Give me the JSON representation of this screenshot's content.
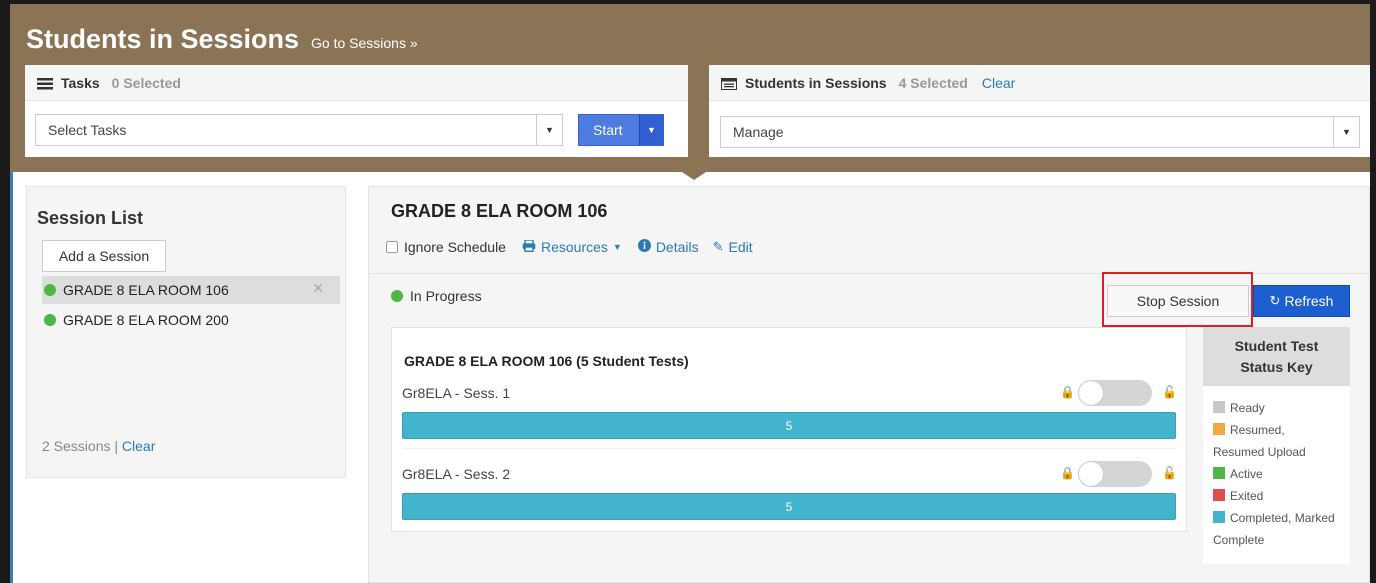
{
  "header": {
    "title": "Students in Sessions",
    "go_link": "Go to Sessions »"
  },
  "tasks_panel": {
    "title": "Tasks",
    "selected": "0 Selected",
    "select_value": "Select Tasks",
    "start_label": "Start"
  },
  "sis_panel": {
    "title": "Students in Sessions",
    "selected": "4 Selected",
    "clear": "Clear",
    "select_value": "Manage"
  },
  "session_list": {
    "title": "Session List",
    "add_label": "Add a Session",
    "items": [
      {
        "label": "GRADE 8 ELA ROOM 106",
        "status_color": "#4db848",
        "active": true
      },
      {
        "label": "GRADE 8 ELA ROOM 200",
        "status_color": "#4db848",
        "active": false
      }
    ],
    "count_text": "2 Sessions |",
    "clear": "Clear"
  },
  "main": {
    "title": "GRADE 8 ELA ROOM 106",
    "ignore_schedule": "Ignore Schedule",
    "resources": "Resources",
    "details": "Details",
    "edit": "Edit",
    "status": "In Progress",
    "stop_label": "Stop Session",
    "refresh_label": "Refresh",
    "tests_title": "GRADE 8 ELA ROOM 106 (5 Student Tests)",
    "tests": [
      {
        "name": "Gr8ELA - Sess. 1",
        "count": "5"
      },
      {
        "name": "Gr8ELA - Sess. 2",
        "count": "5"
      }
    ]
  },
  "status_key": {
    "title_line1": "Student Test",
    "title_line2": "Status Key",
    "items": [
      {
        "label": "Ready",
        "color": "#c8c8c8"
      },
      {
        "label": "Resumed,",
        "color": "#f2a93b"
      },
      {
        "label": "Resumed Upload",
        "color": ""
      },
      {
        "label": "Active",
        "color": "#4db848"
      },
      {
        "label": "Exited",
        "color": "#e04d4d"
      },
      {
        "label": "Completed, Marked",
        "color": "#42b4cc"
      },
      {
        "label": "Complete",
        "color": ""
      }
    ]
  },
  "colors": {
    "header_bg": "#8b7355",
    "primary": "#1d5fd1",
    "link": "#2a7ab8",
    "highlight": "#e31b23"
  }
}
